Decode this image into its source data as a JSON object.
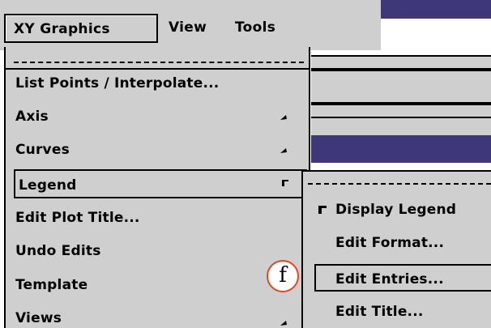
{
  "menubar": {
    "items": [
      {
        "label": "XY Graphics"
      },
      {
        "label": "View"
      },
      {
        "label": "Tools"
      }
    ]
  },
  "xy_menu": {
    "items": [
      {
        "label": "List Points / Interpolate..."
      },
      {
        "label": "Axis"
      },
      {
        "label": "Curves"
      },
      {
        "label": "Legend"
      },
      {
        "label": "Edit Plot Title..."
      },
      {
        "label": "Undo Edits"
      },
      {
        "label": "Template"
      },
      {
        "label": "Views"
      }
    ]
  },
  "legend_submenu": {
    "items": [
      {
        "label": "Display Legend",
        "checked": true
      },
      {
        "label": "Edit Format..."
      },
      {
        "label": "Edit Entries..."
      },
      {
        "label": "Edit Title..."
      }
    ]
  },
  "annotation": {
    "label": "f",
    "color": "#e8461b"
  },
  "colors": {
    "menu_bg": "#cfcfcf",
    "window_blue": "#3e3878"
  }
}
